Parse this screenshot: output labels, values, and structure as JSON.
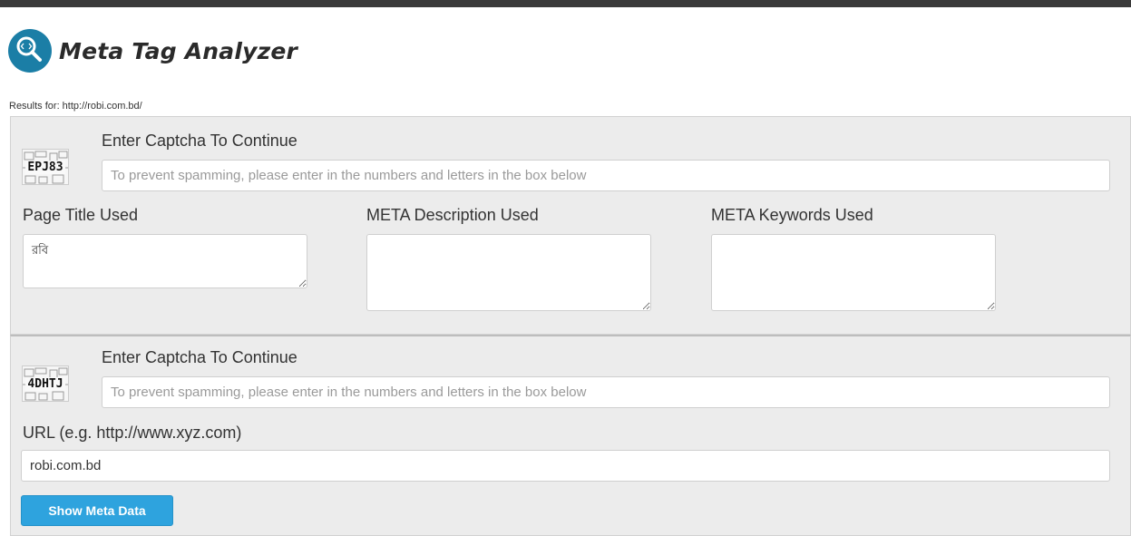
{
  "app": {
    "title": "Meta Tag Analyzer",
    "logo_icon": "magnify-code-icon",
    "accent_color": "#1b7ea6"
  },
  "results": {
    "label": "Results for: http://robi.com.bd/"
  },
  "result_panel": {
    "captcha_label": "Enter Captcha To Continue",
    "captcha_code": "EPJ83",
    "captcha_placeholder": "To prevent spamming, please enter in the numbers and letters in the box below",
    "page_title_label": "Page Title Used",
    "page_title_value": "রবি",
    "meta_description_label": "META Description Used",
    "meta_description_value": "",
    "meta_keywords_label": "META Keywords Used",
    "meta_keywords_value": ""
  },
  "form_panel": {
    "captcha_label": "Enter Captcha To Continue",
    "captcha_code": "4DHTJ",
    "captcha_placeholder": "To prevent spamming, please enter in the numbers and letters in the box below",
    "url_label": "URL (e.g. http://www.xyz.com)",
    "url_value": "robi.com.bd",
    "submit_label": "Show Meta Data",
    "button_color": "#2ea3de"
  }
}
